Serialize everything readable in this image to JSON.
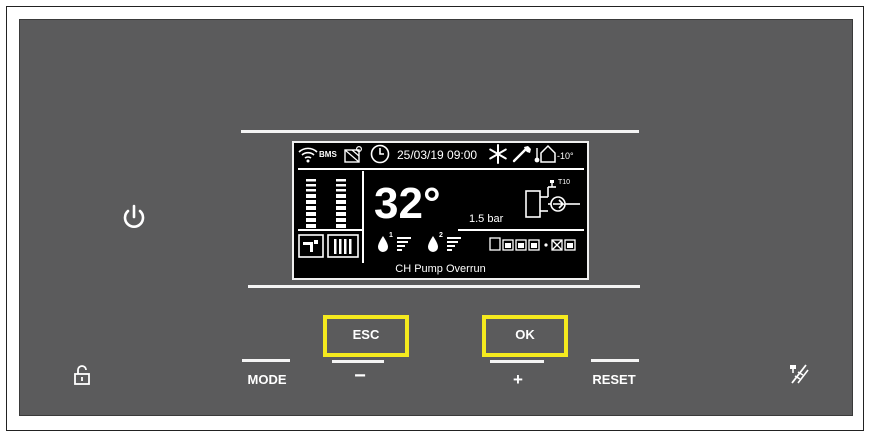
{
  "display": {
    "status_bar": {
      "bms": "BMS",
      "datetime": "25/03/19 09:00",
      "outdoor_temp": "-10°"
    },
    "temperature": "32°",
    "pressure": "1.5 bar",
    "circuit_label": "T10",
    "dhw_level": "1",
    "ch_level": "2",
    "message": "CH Pump Overrun"
  },
  "buttons": {
    "esc": "ESC",
    "ok": "OK",
    "mode": "MODE",
    "minus": "−",
    "plus": "+",
    "reset": "RESET"
  },
  "colors": {
    "panel": "#5b5b5c",
    "highlight": "#f5ea1e",
    "screen": "#000000"
  },
  "icons": [
    "power-icon",
    "unlock-icon",
    "chimney-sweep-icon",
    "wifi-icon",
    "solar-icon",
    "clock-icon",
    "snowflake-icon",
    "wrench-icon",
    "house-temp-icon",
    "radiator-icon",
    "tap-icon",
    "heat-pump-icon"
  ]
}
